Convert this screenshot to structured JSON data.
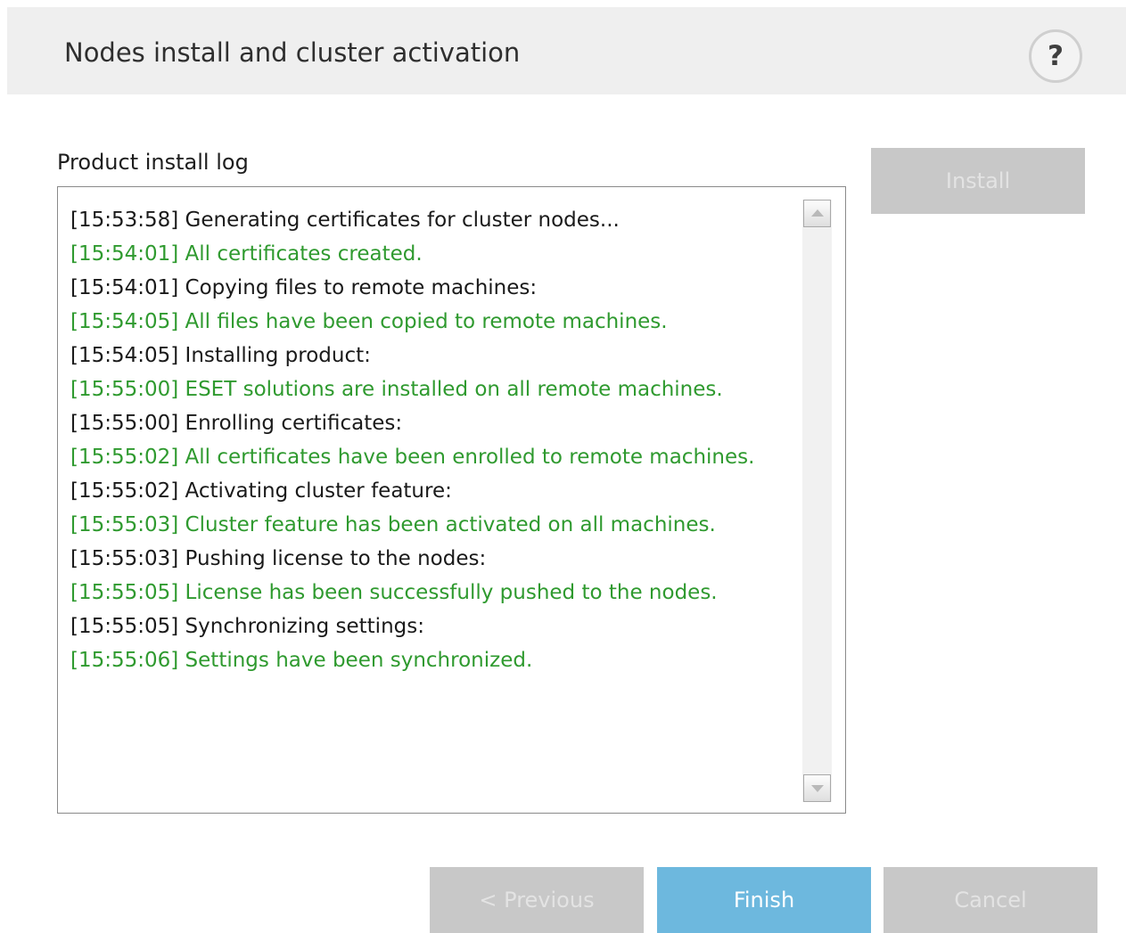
{
  "header": {
    "title": "Nodes install and cluster activation",
    "help_label": "?"
  },
  "log": {
    "label": "Product install log",
    "lines": [
      {
        "text": "[15:53:58] Generating certificates for cluster nodes...",
        "status": "info"
      },
      {
        "text": "[15:54:01] All certificates created.",
        "status": "ok"
      },
      {
        "text": "[15:54:01] Copying files to remote machines:",
        "status": "info"
      },
      {
        "text": "[15:54:05] All files have been copied to remote machines.",
        "status": "ok"
      },
      {
        "text": "[15:54:05] Installing product:",
        "status": "info"
      },
      {
        "text": "[15:55:00] ESET solutions are installed on all remote machines.",
        "status": "ok"
      },
      {
        "text": "[15:55:00] Enrolling certificates:",
        "status": "info"
      },
      {
        "text": "[15:55:02] All certificates have been enrolled to remote machines.",
        "status": "ok"
      },
      {
        "text": "[15:55:02] Activating cluster feature:",
        "status": "info"
      },
      {
        "text": "[15:55:03] Cluster feature has been activated on all machines.",
        "status": "ok"
      },
      {
        "text": "[15:55:03] Pushing license to the nodes:",
        "status": "info"
      },
      {
        "text": "[15:55:05] License has been successfully pushed to the nodes.",
        "status": "ok"
      },
      {
        "text": "[15:55:05] Synchronizing settings:",
        "status": "info"
      },
      {
        "text": "[15:55:06] Settings have been synchronized.",
        "status": "ok"
      }
    ]
  },
  "buttons": {
    "install": "Install",
    "previous": "< Previous",
    "finish": "Finish",
    "cancel": "Cancel"
  },
  "colors": {
    "ok_text": "#2f9a2f",
    "info_text": "#1a1a1a",
    "primary_button": "#6db8de",
    "disabled_button": "#c8c8c8"
  },
  "icons": {
    "help": "help-icon",
    "scroll_up": "scroll-up-arrow-icon",
    "scroll_down": "scroll-down-arrow-icon"
  }
}
